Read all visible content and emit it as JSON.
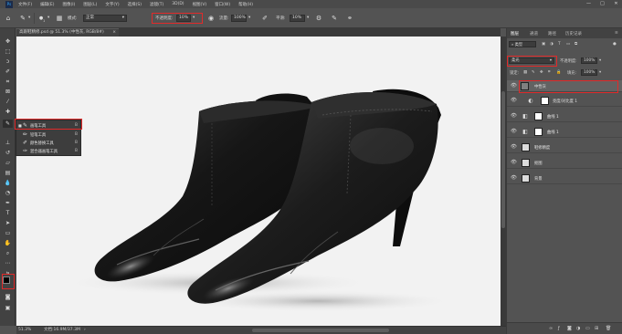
{
  "app": {
    "logo": "Ps"
  },
  "menubar": {
    "items": [
      "文件(F)",
      "编辑(E)",
      "图像(I)",
      "图层(L)",
      "文字(Y)",
      "选择(S)",
      "滤镜(T)",
      "3D(D)",
      "视图(V)",
      "窗口(W)",
      "帮助(H)"
    ],
    "minimize": "—",
    "maximize": "□",
    "close": "✕"
  },
  "options_bar": {
    "tool_icon": "brush-icon",
    "brush_size": "1",
    "mode_label": "模式:",
    "mode_value": "正常",
    "opacity_label": "不透明度:",
    "opacity_value": "10%",
    "flow_label": "流量:",
    "flow_value": "100%",
    "smoothing_label": "平滑:",
    "smoothing_value": "10%"
  },
  "document": {
    "tab_title": "高跟鞋精修.psd @ 51.3% (中性灰, RGB/8#)",
    "tab_close": "×"
  },
  "flyout": {
    "items": [
      {
        "name": "画笔工具",
        "key": "B",
        "active": true
      },
      {
        "name": "铅笔工具",
        "key": "B",
        "active": false
      },
      {
        "name": "颜色替换工具",
        "key": "B",
        "active": false
      },
      {
        "name": "混合器画笔工具",
        "key": "B",
        "active": false
      }
    ]
  },
  "statusbar": {
    "zoom": "51.3%",
    "doc_size": "文档:16.9M/37.3M",
    "arrow": "›"
  },
  "layers_panel": {
    "tabs": [
      "图层",
      "通道",
      "路径",
      "历史记录"
    ],
    "filter_label": "类型",
    "blend_mode": "柔光",
    "opacity_label": "不透明度:",
    "opacity_value": "100%",
    "lock_label": "锁定:",
    "fill_label": "填充:",
    "fill_value": "100%",
    "layers": [
      {
        "name": "中性灰",
        "type": "gray",
        "selected": true
      },
      {
        "name": "亮度/对比度 1",
        "type": "adjust"
      },
      {
        "name": "曲线 1",
        "type": "curves"
      },
      {
        "name": "曲线 1",
        "type": "curves"
      },
      {
        "name": "鞋修精度",
        "type": "photo"
      },
      {
        "name": "抠图",
        "type": "photo"
      },
      {
        "name": "背景",
        "type": "photo"
      }
    ]
  },
  "colors": {
    "highlight": "#e12a2a",
    "canvas_bg": "#f2f2f2",
    "ui_dark": "#424242",
    "ui_mid": "#535353"
  }
}
